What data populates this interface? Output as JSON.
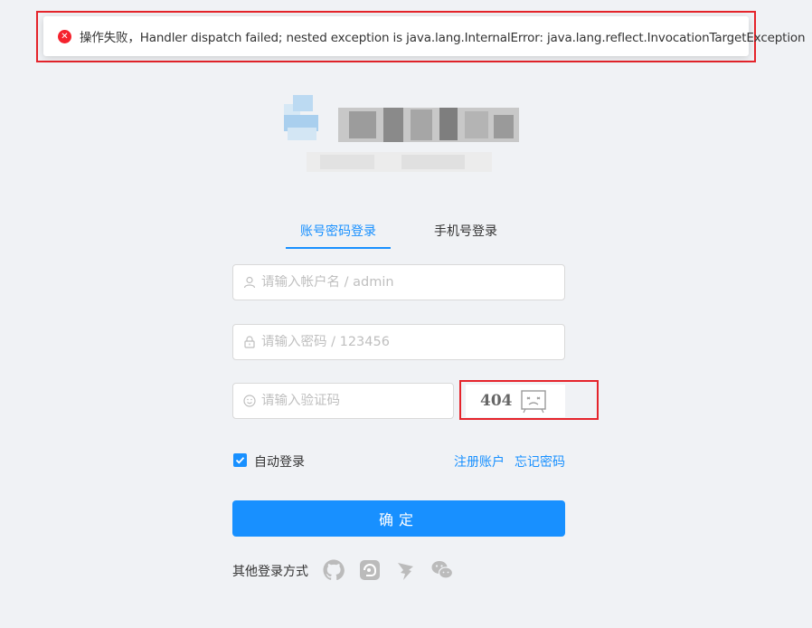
{
  "alert": {
    "message": "操作失败，Handler dispatch failed; nested exception is java.lang.InternalError: java.lang.reflect.InvocationTargetException",
    "icon": "error-circle-icon",
    "color": "#f5222d"
  },
  "tabs": {
    "account": "账号密码登录",
    "phone": "手机号登录"
  },
  "form": {
    "username_placeholder": "请输入帐户名 / admin",
    "password_placeholder": "请输入密码 / 123456",
    "captcha_placeholder": "请输入验证码",
    "captcha_text": "404",
    "remember_label": "自动登录",
    "register_link": "注册账户",
    "forgot_link": "忘记密码",
    "submit_label": "确定"
  },
  "other_login": {
    "label": "其他登录方式",
    "icons": [
      "github-icon",
      "gitee-icon",
      "dingtalk-icon",
      "wechat-icon"
    ]
  },
  "colors": {
    "primary": "#1890ff",
    "error": "#f5222d",
    "background": "#f0f2f5"
  }
}
